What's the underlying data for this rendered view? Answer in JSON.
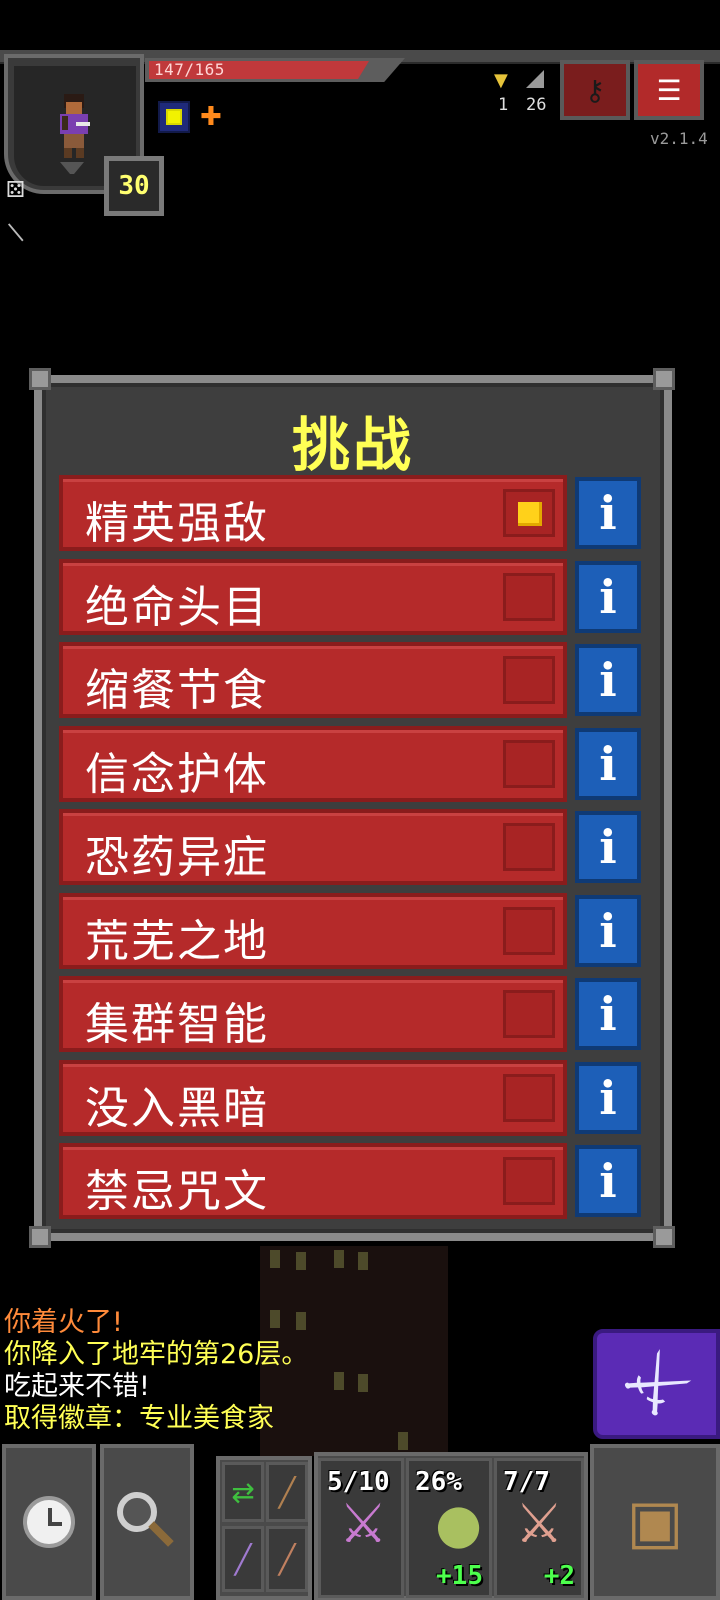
{
  "hud": {
    "hp_text": "147/165",
    "hp_fraction": 0.89,
    "level": "30",
    "keys_count": "1",
    "depth": "26",
    "version": "v2.1.4",
    "icons": {
      "journal": "key-icon",
      "menu": "menu-icon",
      "trophy": "trophy-icon",
      "depth": "stairs-icon"
    }
  },
  "challenges": {
    "title": "挑战",
    "items": [
      {
        "label": "精英强敌",
        "checked": true
      },
      {
        "label": "绝命头目",
        "checked": false
      },
      {
        "label": "缩餐节食",
        "checked": false
      },
      {
        "label": "信念护体",
        "checked": false
      },
      {
        "label": "恐药异症",
        "checked": false
      },
      {
        "label": "荒芜之地",
        "checked": false
      },
      {
        "label": "集群智能",
        "checked": false
      },
      {
        "label": "没入黑暗",
        "checked": false
      },
      {
        "label": "禁忌咒文",
        "checked": false
      }
    ],
    "info_glyph": "i"
  },
  "log": [
    {
      "text": "你着火了!",
      "color": "#ff8a3a"
    },
    {
      "text": "你降入了地牢的第26层。",
      "color": "#ffff55"
    },
    {
      "text": "吃起来不错!",
      "color": "#ffffff"
    },
    {
      "text": "取得徽章：专业美食家",
      "color": "#ffff55"
    }
  ],
  "quickslots": [
    {
      "top": "5/10",
      "bottom": ""
    },
    {
      "top": "26%",
      "bottom": "+15"
    },
    {
      "top": "7/7",
      "bottom": "+2"
    }
  ],
  "colors": {
    "row_bg": "#b52a2a",
    "info_bg": "#1d5fb8",
    "title": "#ffff55",
    "attack_bg": "#5b2bb5"
  }
}
